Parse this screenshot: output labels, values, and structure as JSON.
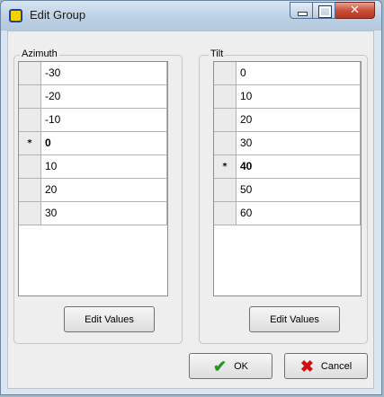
{
  "window": {
    "title": "Edit Group"
  },
  "azimuth": {
    "label": "Azimuth",
    "rows": [
      {
        "marker": "",
        "value": "-30"
      },
      {
        "marker": "",
        "value": "-20"
      },
      {
        "marker": "",
        "value": "-10"
      },
      {
        "marker": "*",
        "value": "0"
      },
      {
        "marker": "",
        "value": "10"
      },
      {
        "marker": "",
        "value": "20"
      },
      {
        "marker": "",
        "value": "30"
      }
    ],
    "current_index": 3,
    "edit_label": "Edit Values"
  },
  "tilt": {
    "label": "Tilt",
    "rows": [
      {
        "marker": "",
        "value": "0"
      },
      {
        "marker": "",
        "value": "10"
      },
      {
        "marker": "",
        "value": "20"
      },
      {
        "marker": "",
        "value": "30"
      },
      {
        "marker": "*",
        "value": "40"
      },
      {
        "marker": "",
        "value": "50"
      },
      {
        "marker": "",
        "value": "60"
      }
    ],
    "current_index": 4,
    "edit_label": "Edit Values"
  },
  "footer": {
    "ok_label": "OK",
    "cancel_label": "Cancel"
  },
  "colors": {
    "ok_icon": "#1d9a1d",
    "cancel_icon": "#d01010",
    "title_bar": "#bdd1e4"
  },
  "icons": {
    "app": "group-app-icon",
    "ok": "check-icon",
    "cancel": "x-icon"
  }
}
